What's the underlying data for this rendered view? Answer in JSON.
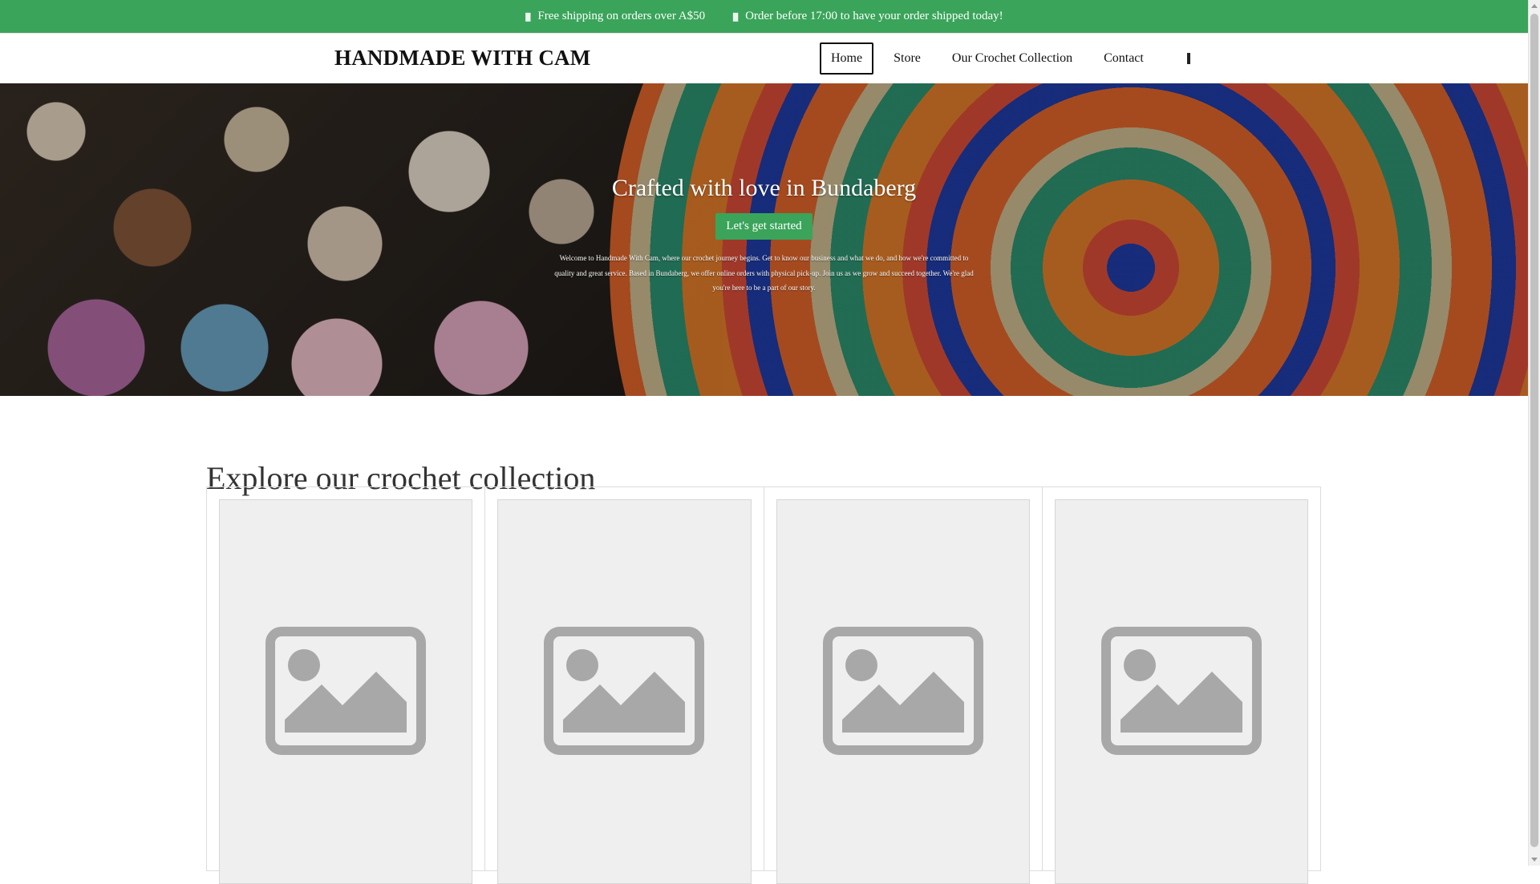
{
  "colors": {
    "topbar_bg": "#3aa45a",
    "button_bg": "#3aa45a"
  },
  "topbar": {
    "messages": [
      {
        "icon": "truck-icon",
        "text": "Free shipping on orders over A$50"
      },
      {
        "icon": "clock-icon",
        "text": "Order before 17:00 to have your order shipped today!"
      }
    ]
  },
  "header": {
    "logo": "HANDMADE WITH CAM",
    "nav": [
      {
        "label": "Home",
        "active": true
      },
      {
        "label": "Store",
        "active": false
      },
      {
        "label": "Our Crochet Collection",
        "active": false
      },
      {
        "label": "Contact",
        "active": false
      }
    ],
    "search_icon": "search-icon"
  },
  "hero": {
    "title": "Crafted with love in Bundaberg",
    "button_label": "Let's get started",
    "text": "Welcome to Handmade With Cam, where our crochet journey begins. Get to know our business and what we do, and how we're committed to quality and great service. Based in Bundaberg, we offer online orders with physical pick-up. Join us as we grow and succeed together. We're glad you're here to be a part of our story."
  },
  "collection": {
    "title": "Explore our crochet collection",
    "products": [
      {
        "image_icon": "image-placeholder-icon"
      },
      {
        "image_icon": "image-placeholder-icon"
      },
      {
        "image_icon": "image-placeholder-icon"
      },
      {
        "image_icon": "image-placeholder-icon"
      }
    ]
  }
}
